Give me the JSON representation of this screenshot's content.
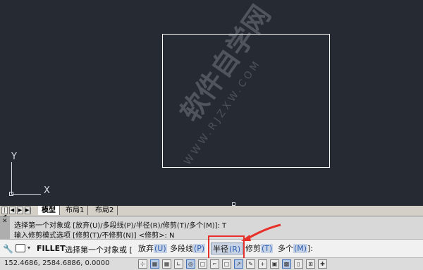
{
  "canvas": {
    "ucs": {
      "y_label": "Y",
      "x_label": "X"
    },
    "watermark": {
      "text": "软件自学网",
      "url": "WWW.RJZXW.COM"
    }
  },
  "tabs": {
    "nav": [
      "|◀",
      "◀",
      "▶",
      "▶|"
    ],
    "items": [
      {
        "label": "模型",
        "active": true
      },
      {
        "label": "布局1",
        "active": false
      },
      {
        "label": "布局2",
        "active": false
      }
    ]
  },
  "history": {
    "close_glyph": "✕",
    "line1": "选择第一个对象或 [放弃(U)/多段线(P)/半径(R)/修剪(T)/多个(M)]: T",
    "line2": "输入修剪模式选项 [修剪(T)/不修剪(N)] <修剪>: N"
  },
  "command": {
    "name": "FILLET",
    "prompt": "选择第一个对象或 [",
    "options": [
      {
        "label": "放弃",
        "key": "(U)",
        "highlight": false
      },
      {
        "label": "多段线",
        "key": "(P)",
        "highlight": false
      },
      {
        "label": "半径",
        "key": "(R)",
        "highlight": true
      },
      {
        "label": "修剪",
        "key": "(T)",
        "highlight": false
      },
      {
        "label": "多个",
        "key": "(M)",
        "highlight": false
      }
    ],
    "suffix": "]:"
  },
  "status": {
    "coords": "152.4686, 2584.6886, 0.0000",
    "buttons": [
      "snap",
      "grid",
      "ortho",
      "polar",
      "osnap",
      "3dosnap",
      "otrack",
      "ducs",
      "dyn",
      "lwt",
      "tp",
      "qp",
      "sc",
      "am"
    ]
  },
  "colors": {
    "canvas_bg": "#262a33",
    "callout": "#e8302a",
    "option_key": "#2f5fb0"
  }
}
